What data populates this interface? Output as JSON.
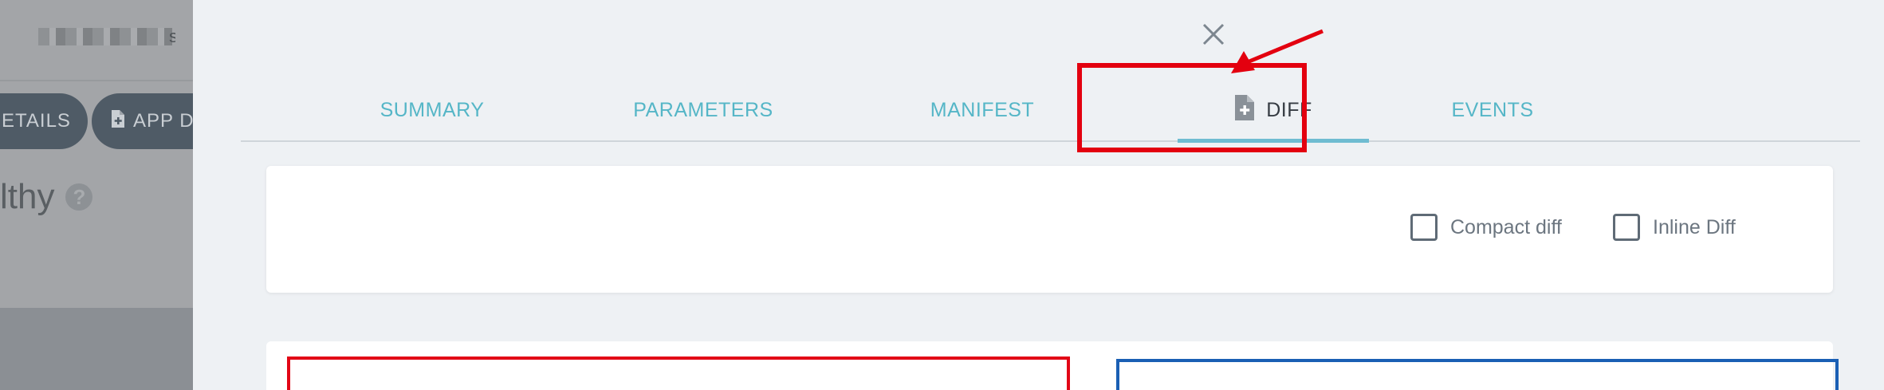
{
  "background_app": {
    "app_title_visible_fragment": "s",
    "details_button_label": "ETAILS",
    "app_diff_button_label": "APP D",
    "health_status": "lthy"
  },
  "panel": {
    "tabs": [
      {
        "label": "SUMMARY",
        "active": false
      },
      {
        "label": "PARAMETERS",
        "active": false
      },
      {
        "label": "MANIFEST",
        "active": false
      },
      {
        "label": "DIFF",
        "active": true,
        "icon": "file-diff-icon"
      },
      {
        "label": "EVENTS",
        "active": false
      }
    ],
    "options": {
      "compact_diff_label": "Compact diff",
      "compact_diff_checked": false,
      "inline_diff_label": "Inline Diff",
      "inline_diff_checked": false
    }
  },
  "annotations": {
    "highlight_color": "#e3000f",
    "arrow_color": "#e3000f",
    "diff_left_border_color": "#e20616",
    "diff_right_border_color": "#1a5fb4"
  },
  "colors": {
    "tab_inactive": "#55b6c7",
    "tab_active_text": "#363c43",
    "tab_active_underline": "#6fbcd1",
    "panel_bg": "#eef1f4"
  }
}
